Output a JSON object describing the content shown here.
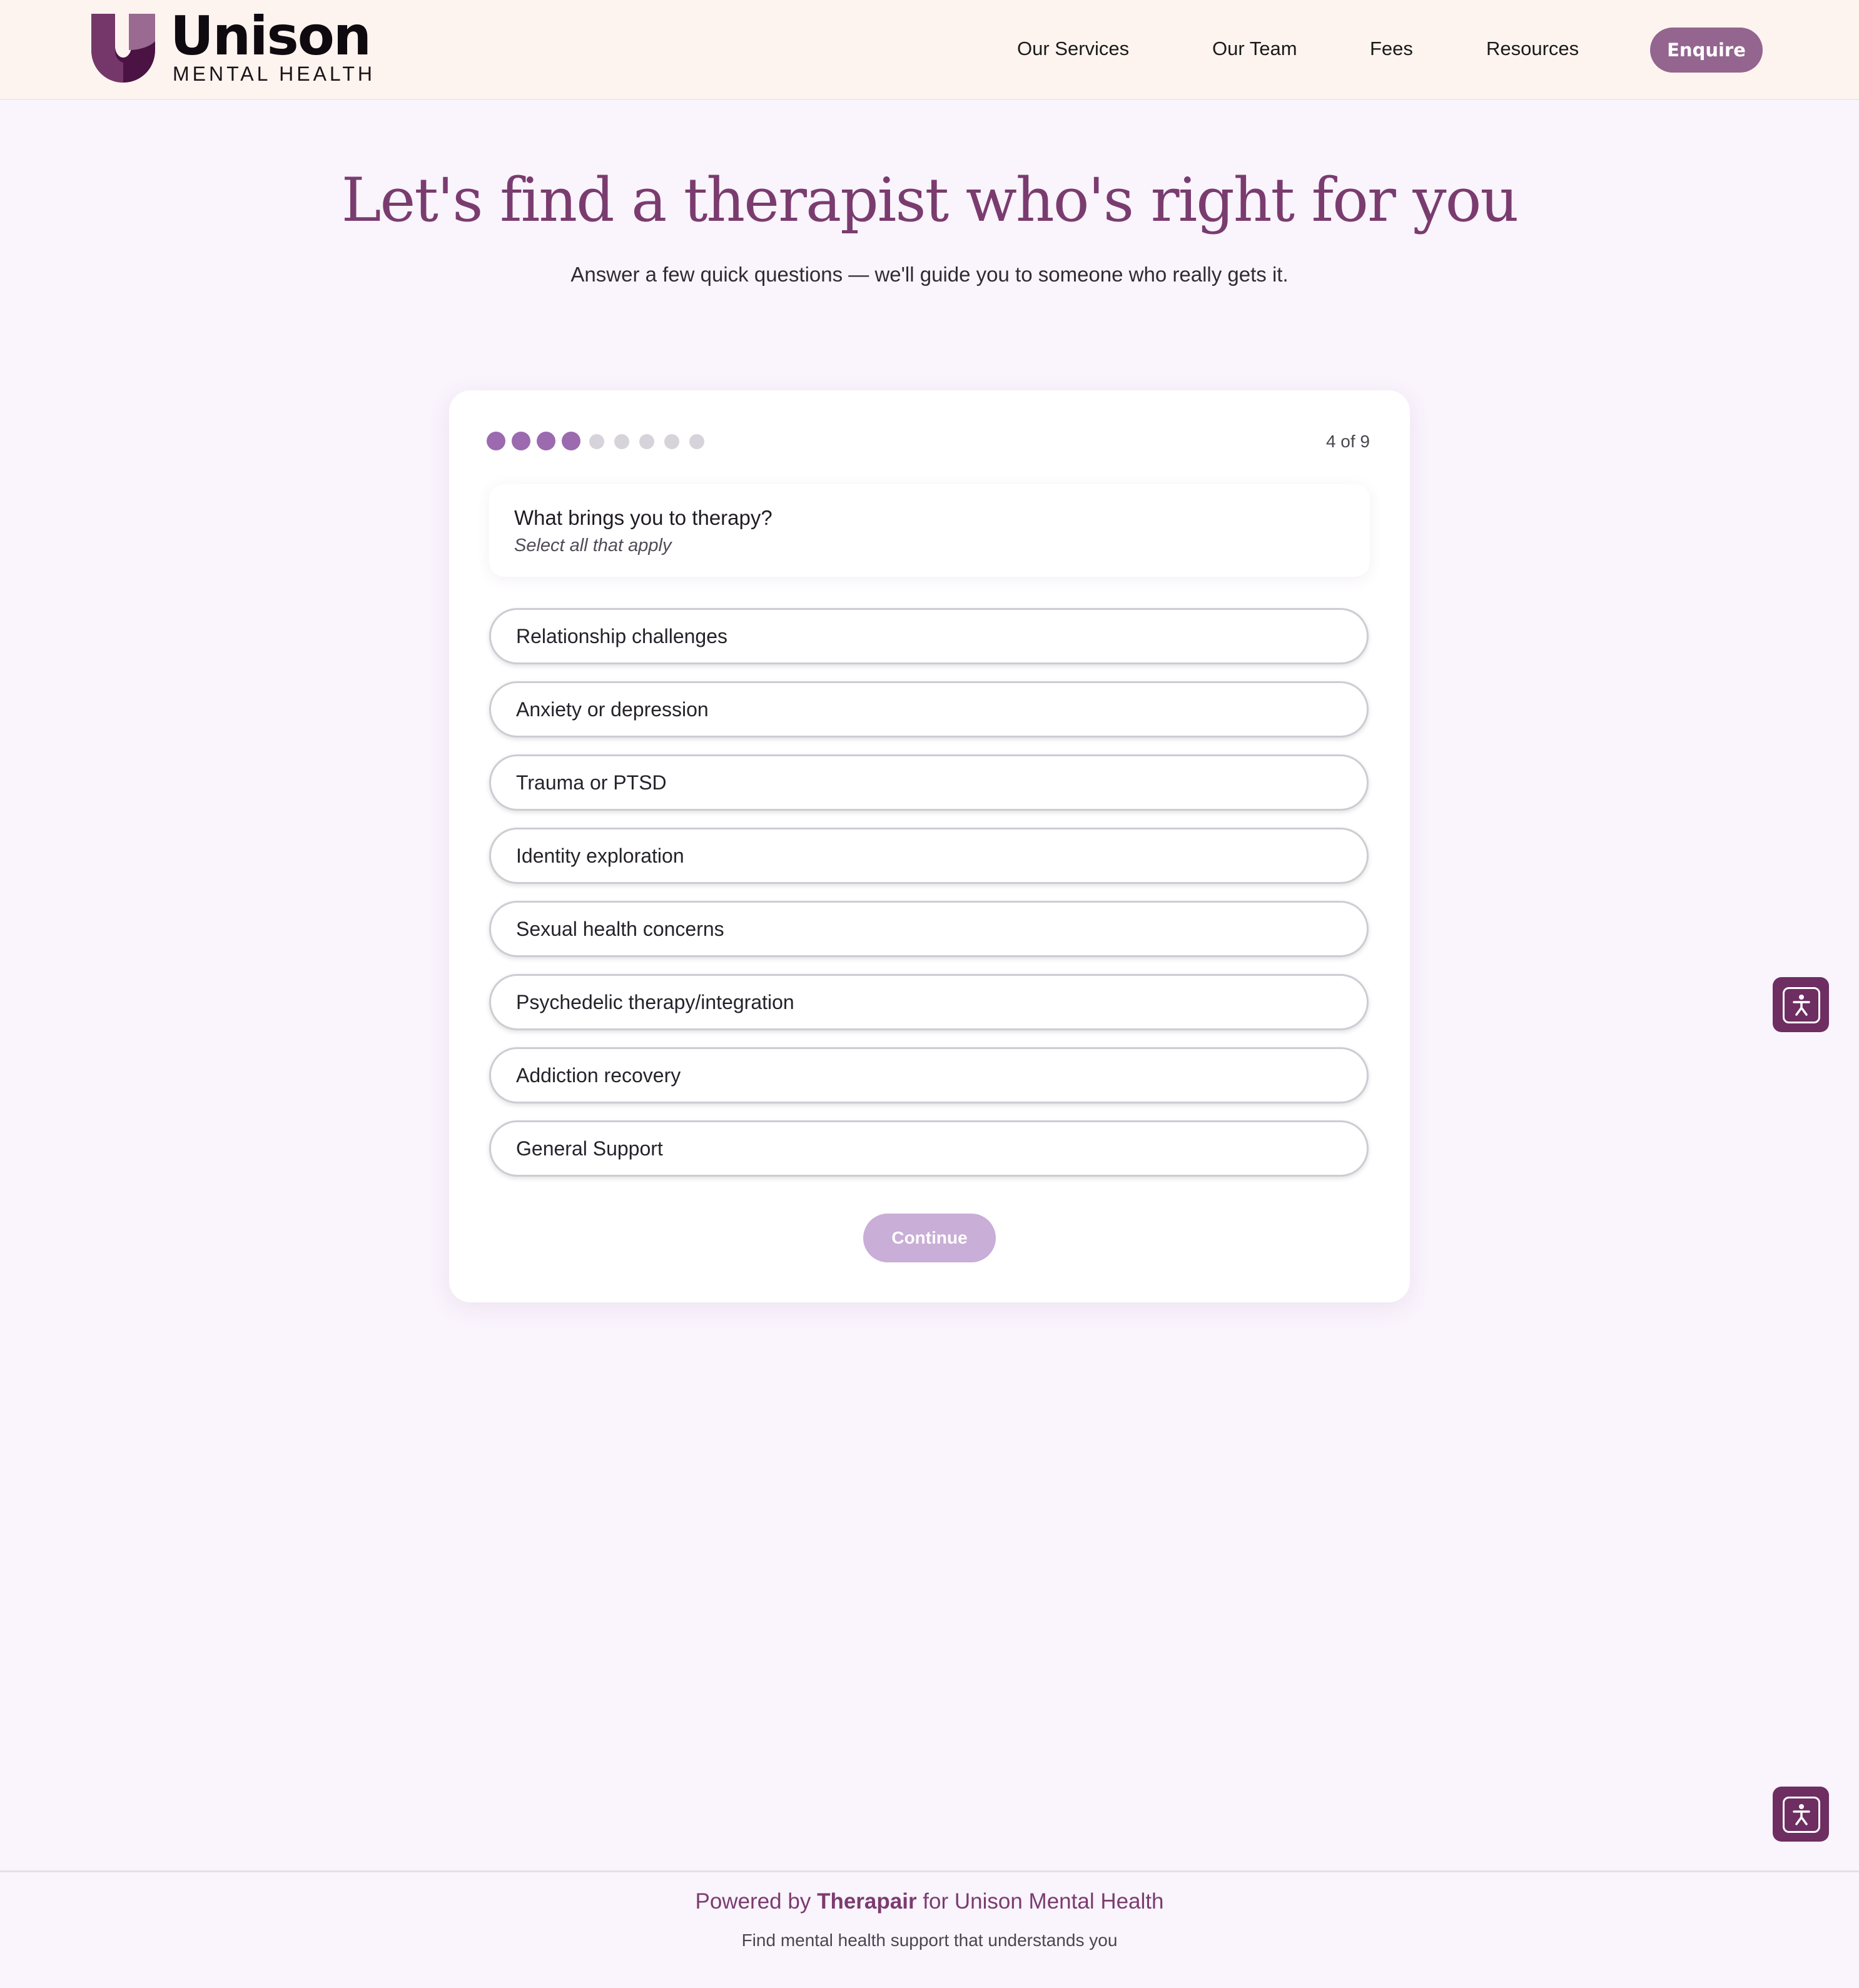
{
  "brand": {
    "name": "Unison",
    "subtitle": "MENTAL HEALTH",
    "logo_icon": "u-shape-logo-icon",
    "color_primary": "#7a3c6f",
    "color_dark": "#4a1343",
    "color_light": "#94658f"
  },
  "nav": {
    "items": [
      {
        "label": "Our Services"
      },
      {
        "label": "Our Team"
      },
      {
        "label": "Fees"
      },
      {
        "label": "Resources"
      }
    ],
    "cta_label": "Enquire"
  },
  "hero": {
    "title": "Let's find a therapist who's right for you",
    "subtitle": "Answer a few quick questions — we'll guide you to someone who really gets it."
  },
  "progress": {
    "current": 4,
    "total": 9,
    "label": "4 of 9",
    "active_color": "#9b6aaf",
    "inactive_color": "#d6d3da"
  },
  "question": {
    "title": "What brings you to therapy?",
    "hint": "Select all that apply",
    "options": [
      {
        "label": "Relationship challenges",
        "selected": false
      },
      {
        "label": "Anxiety or depression",
        "selected": false
      },
      {
        "label": "Trauma or PTSD",
        "selected": false
      },
      {
        "label": "Identity exploration",
        "selected": false
      },
      {
        "label": "Sexual health concerns",
        "selected": false
      },
      {
        "label": "Psychedelic therapy/integration",
        "selected": false
      },
      {
        "label": "Addiction recovery",
        "selected": false
      },
      {
        "label": "General Support",
        "selected": false
      }
    ],
    "continue_label": "Continue",
    "continue_disabled": true
  },
  "accessibility": {
    "icon": "accessibility-person-icon"
  },
  "footer": {
    "powered_prefix": "Powered by",
    "powered_brand": "Therapair",
    "powered_suffix": "for Unison Mental Health",
    "tagline": "Find mental health support that understands you"
  }
}
